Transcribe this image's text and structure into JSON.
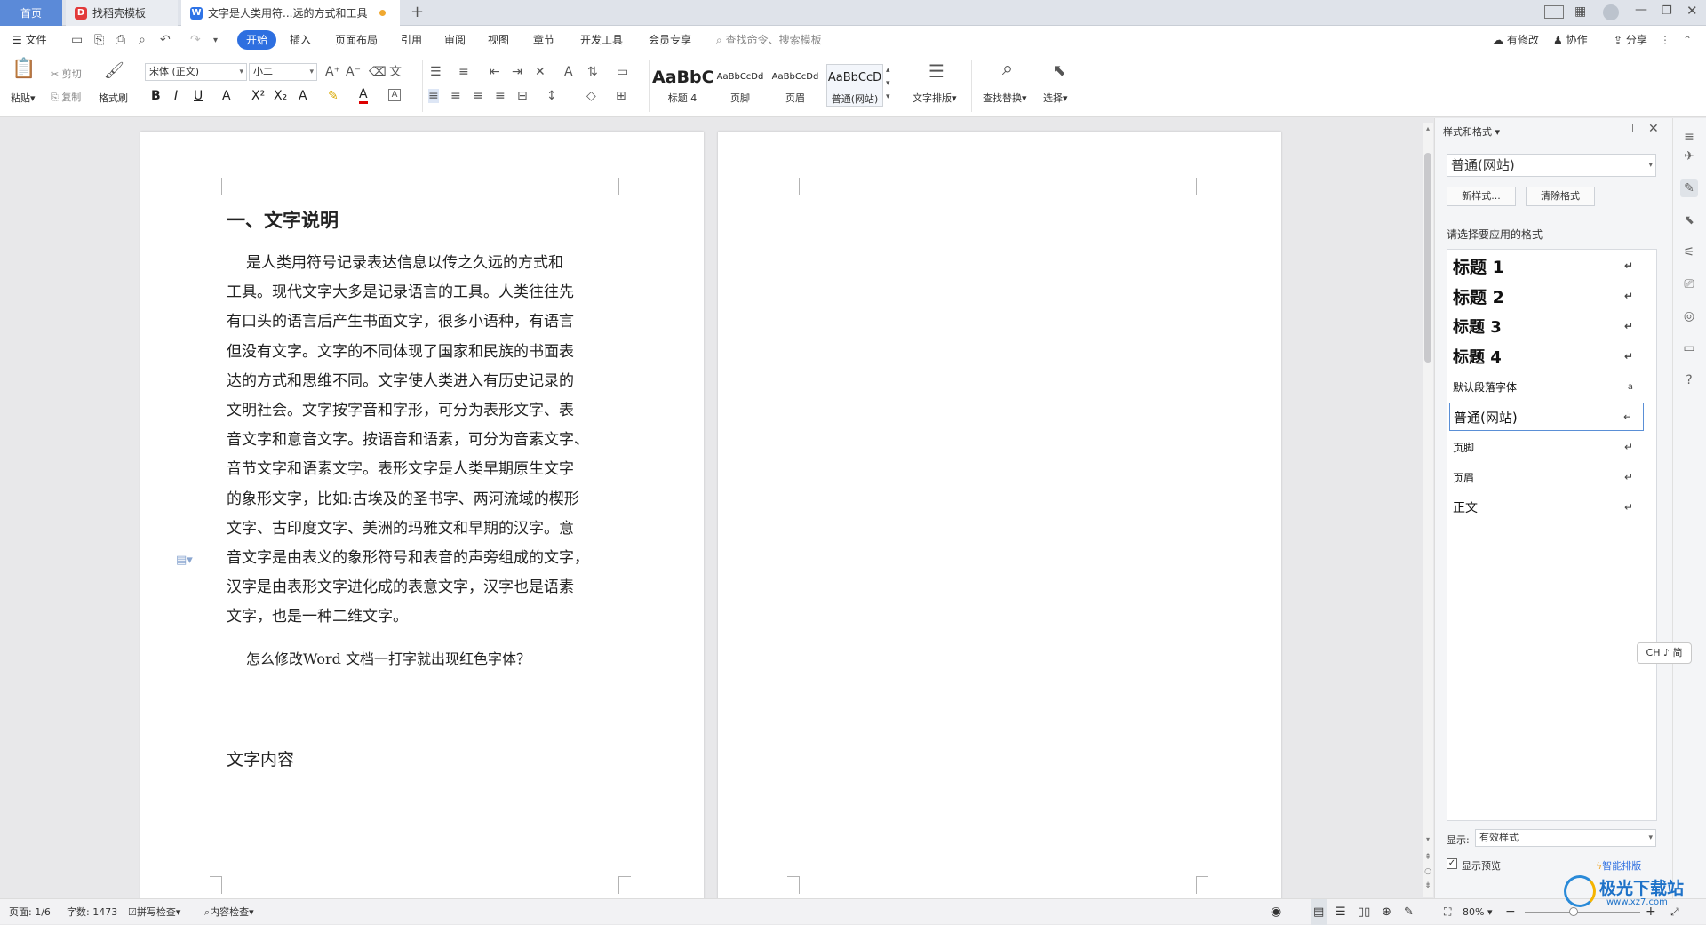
{
  "tabs": {
    "home": "首页",
    "template": "找稻壳模板",
    "doc": "文字是人类用符...远的方式和工具"
  },
  "menu": {
    "file": "文件",
    "items": [
      "开始",
      "插入",
      "页面布局",
      "引用",
      "审阅",
      "视图",
      "章节",
      "开发工具",
      "会员专享"
    ],
    "search_placeholder": "查找命令、搜索模板",
    "right": {
      "modified": "有修改",
      "collab": "协作",
      "share": "分享"
    }
  },
  "ribbon": {
    "paste": "粘贴",
    "cut": "剪切",
    "copy": "复制",
    "format_painter": "格式刷",
    "font_name": "宋体 (正文)",
    "font_size": "小二",
    "styles": [
      {
        "preview": "AaBbC",
        "label": "标题 4"
      },
      {
        "preview": "AaBbCcDd",
        "label": "页脚"
      },
      {
        "preview": "AaBbCcDd",
        "label": "页眉"
      },
      {
        "preview": "AaBbCcD",
        "label": "普通(网站)"
      }
    ],
    "text_layout": "文字排版",
    "find_replace": "查找替换",
    "select": "选择"
  },
  "document": {
    "heading": "一、文字说明",
    "paragraph_lines": [
      "是人类用符号记录表达信息以传之久远的方式和",
      "工具。现代文字大多是记录语言的工具。人类往往先",
      "有口头的语言后产生书面文字，很多小语种，有语言",
      "但没有文字。文字的不同体现了国家和民族的书面表",
      "达的方式和思维不同。文字使人类进入有历史记录的",
      "文明社会。文字按字音和字形，可分为表形文字、表",
      "音文字和意音文字。按语音和语素，可分为音素文字、",
      "音节文字和语素文字。表形文字是人类早期原生文字",
      "的象形文字，比如:古埃及的圣书字、两河流域的楔形",
      "文字、古印度文字、美洲的玛雅文和早期的汉字。意",
      "音文字是由表义的象形符号和表音的声旁组成的文字，",
      "汉字是由表形文字进化成的表意文字，汉字也是语素",
      "文字，也是一种二维文字。"
    ],
    "question": "怎么修改Word 文档一打字就出现红色字体？",
    "subheading": "文字内容"
  },
  "sidebar": {
    "title": "样式和格式",
    "current_style": "普通(网站)",
    "new_style": "新样式...",
    "clear_format": "清除格式",
    "prompt": "请选择要应用的格式",
    "styles": [
      {
        "label": "标题 1",
        "mark": "↵"
      },
      {
        "label": "标题 2",
        "mark": "↵"
      },
      {
        "label": "标题 3",
        "mark": "↵"
      },
      {
        "label": "标题 4",
        "mark": "↵"
      },
      {
        "label": "默认段落字体",
        "mark": "a"
      },
      {
        "label": "普通(网站)",
        "mark": "↵"
      },
      {
        "label": "页脚",
        "mark": "↵"
      },
      {
        "label": "页眉",
        "mark": "↵"
      },
      {
        "label": "正文",
        "mark": "↵"
      }
    ],
    "show_label": "显示:",
    "show_value": "有效样式",
    "show_preview": "显示预览",
    "smart_layout": "智能排版"
  },
  "ime": "CH ♪ 简",
  "status": {
    "page": "页面: 1/6",
    "words": "字数: 1473",
    "spell": "拼写检查",
    "content": "内容检查",
    "zoom": "80%"
  },
  "watermark": "极光下载站",
  "watermark_url": "www.xz7.com",
  "colors": {
    "accent": "#2e6fe0",
    "home_tab": "#5b8ad8",
    "doc_icon": "#2e73e6",
    "template_icon": "#e23a3a"
  }
}
